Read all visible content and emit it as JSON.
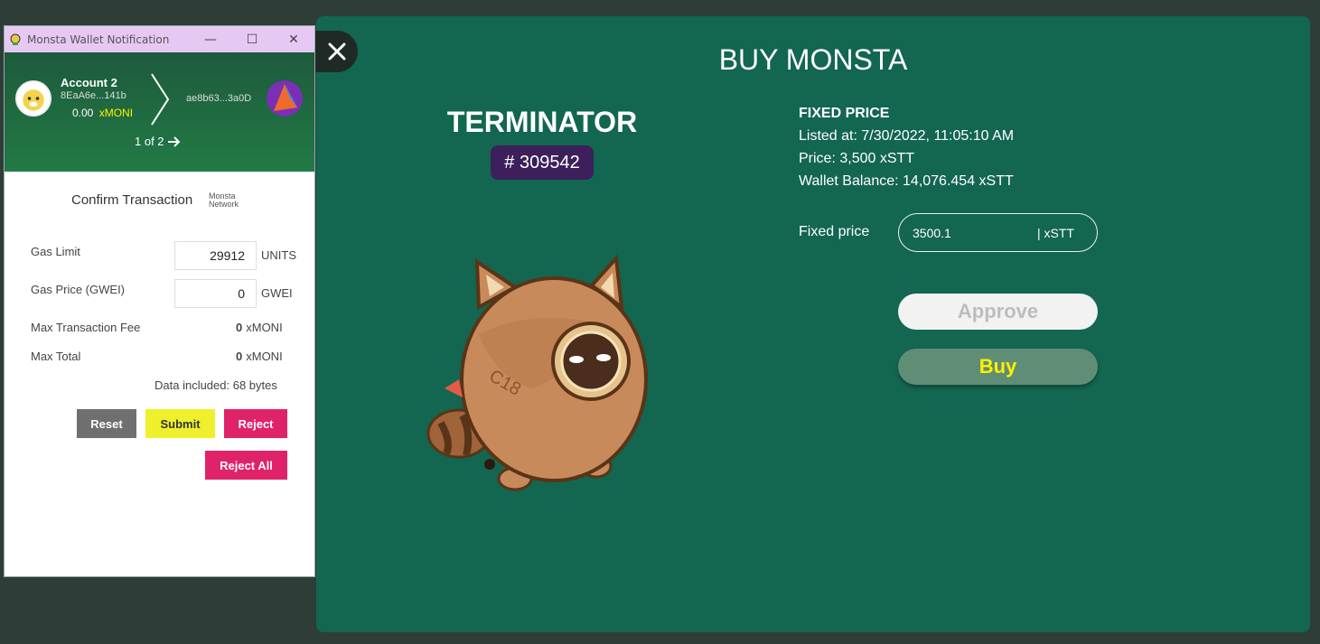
{
  "modal": {
    "title": "BUY MONSTA",
    "close_icon": "close-icon",
    "nft": {
      "name": "TERMINATOR",
      "id": "# 309542"
    },
    "info": {
      "heading": "FIXED PRICE",
      "listed_at": "Listed at: 7/30/2022, 11:05:10 AM",
      "price": "Price: 3,500 xSTT",
      "wallet_balance": "Wallet Balance: 14,076.454 xSTT"
    },
    "fixed_price": {
      "label": "Fixed price",
      "value": "3500.1",
      "unit": "| xSTT"
    },
    "buttons": {
      "approve": "Approve",
      "buy": "Buy"
    },
    "colors": {
      "background": "#136650",
      "buy_text": "#fff200",
      "id_badge": "#3d1f5c"
    }
  },
  "wallet": {
    "window_title": "Monsta Wallet Notification",
    "account": {
      "name": "Account 2",
      "address": "8EaA6e...141b",
      "balance": "0.00",
      "unit": "xMONI"
    },
    "destination": "ae8b63...3a0D",
    "pager": "1 of 2",
    "confirm_title": "Confirm Transaction",
    "network_line1": "Monsta",
    "network_line2": "Network",
    "gas_limit": {
      "label": "Gas Limit",
      "value": "29912",
      "unit": "UNITS"
    },
    "gas_price": {
      "label": "Gas Price (GWEI)",
      "value": "0",
      "unit": "GWEI"
    },
    "max_fee": {
      "label": "Max Transaction Fee",
      "value": "0",
      "unit": "xMONI"
    },
    "max_total": {
      "label": "Max Total",
      "value": "0",
      "unit": "xMONI"
    },
    "data_included": "Data included: 68 bytes",
    "buttons": {
      "reset": "Reset",
      "submit": "Submit",
      "reject": "Reject",
      "reject_all": "Reject All"
    }
  }
}
